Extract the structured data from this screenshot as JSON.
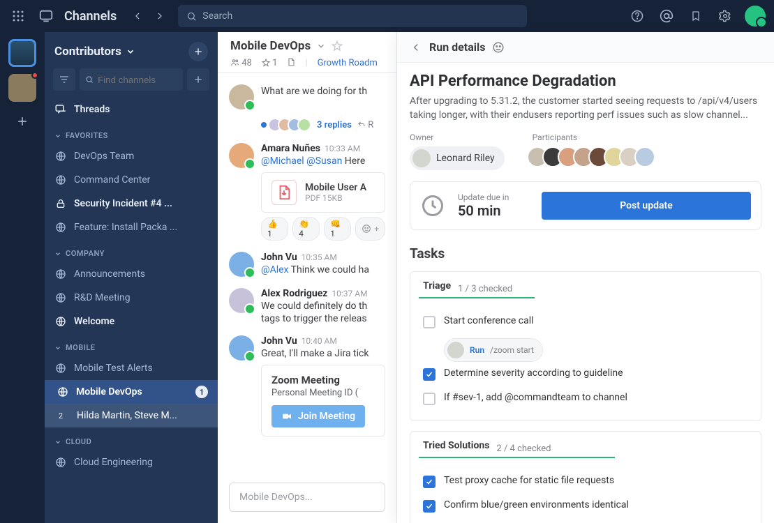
{
  "topbar": {
    "title": "Channels",
    "search_placeholder": "Search"
  },
  "sidebar": {
    "workspace": "Contributors",
    "find_placeholder": "Find channels",
    "threads_label": "Threads",
    "sections": [
      {
        "name": "FAVORITES",
        "items": [
          {
            "icon": "globe",
            "label": "DevOps Team"
          },
          {
            "icon": "globe",
            "label": "Command Center"
          },
          {
            "icon": "lock",
            "label": "Security Incident #4 ...",
            "bold": true
          },
          {
            "icon": "globe",
            "label": "Feature: Install Packa ..."
          }
        ]
      },
      {
        "name": "COMPANY",
        "items": [
          {
            "icon": "globe",
            "label": "Announcements"
          },
          {
            "icon": "globe",
            "label": "R&D Meeting"
          },
          {
            "icon": "globe",
            "label": "Welcome",
            "bold": true
          }
        ]
      },
      {
        "name": "MOBILE",
        "items": [
          {
            "icon": "globe",
            "label": "Mobile Test Alerts"
          },
          {
            "icon": "globe",
            "label": "Mobile DevOps",
            "bold": true,
            "active": true,
            "count": "1"
          },
          {
            "numbadge": "2",
            "label": "Hilda Martin, Steve M..."
          }
        ]
      },
      {
        "name": "CLOUD",
        "items": [
          {
            "icon": "globe",
            "label": "Cloud Engineering"
          }
        ]
      }
    ]
  },
  "channel": {
    "name": "Mobile DevOps",
    "members": "48",
    "pinned": "1",
    "link_label": "Growth Roadm",
    "composer_placeholder": "Mobile DevOps...",
    "thread": {
      "replies": "3 replies",
      "reply_action": "R"
    },
    "messages": [
      {
        "name": "",
        "time": "",
        "text": "What are we doing for th"
      },
      {
        "name": "Amara Nuñes",
        "time": "10:33 AM",
        "text_mentions": "@Michael @Susan",
        "text_rest": " Here",
        "file": {
          "name": "Mobile User A",
          "meta": "PDF 15KB"
        },
        "reactions": [
          "👍 1",
          "👏 4",
          "👊 1"
        ]
      },
      {
        "name": "John Vu",
        "time": "10:35 AM",
        "text_mentions": "@Alex",
        "text_rest": " Think we could ha"
      },
      {
        "name": "Alex Rodriguez",
        "time": "10:37 AM",
        "text": "We could definitely do th",
        "text2": "tags to trigger the releas"
      },
      {
        "name": "John Vu",
        "time": "10:40 AM",
        "text": "Great, I'll make a Jira tick",
        "zoom": {
          "title": "Zoom Meeting",
          "sub": "Personal Meeting ID (",
          "button": "Join Meeting"
        }
      }
    ]
  },
  "panel": {
    "title": "Run details",
    "run_title": "API Performance Degradation",
    "run_desc": "After upgrading to 5.31.2, the customer started seeing requests to /api/v4/users taking longer, with their endusers reporting perf issues such as slow channel...",
    "owner_label": "Owner",
    "owner_name": "Leonard Riley",
    "participants_label": "Participants",
    "update_label": "Update due in",
    "update_time": "50 min",
    "post_button": "Post update",
    "tasks_label": "Tasks",
    "sections": [
      {
        "name": "Triage",
        "progress": "1 / 3 checked",
        "items": [
          {
            "checked": false,
            "text": "Start conference call",
            "run": {
              "label": "Run",
              "cmd": "/zoom start"
            }
          },
          {
            "checked": true,
            "text": "Determine severity according to guideline"
          },
          {
            "checked": false,
            "text": "If #sev-1, add @commandteam to channel"
          }
        ]
      },
      {
        "name": "Tried Solutions",
        "progress": "2 / 4 checked",
        "items": [
          {
            "checked": true,
            "text": "Test proxy cache for static file requests"
          },
          {
            "checked": true,
            "text": "Confirm blue/green environments identical"
          }
        ]
      }
    ]
  }
}
